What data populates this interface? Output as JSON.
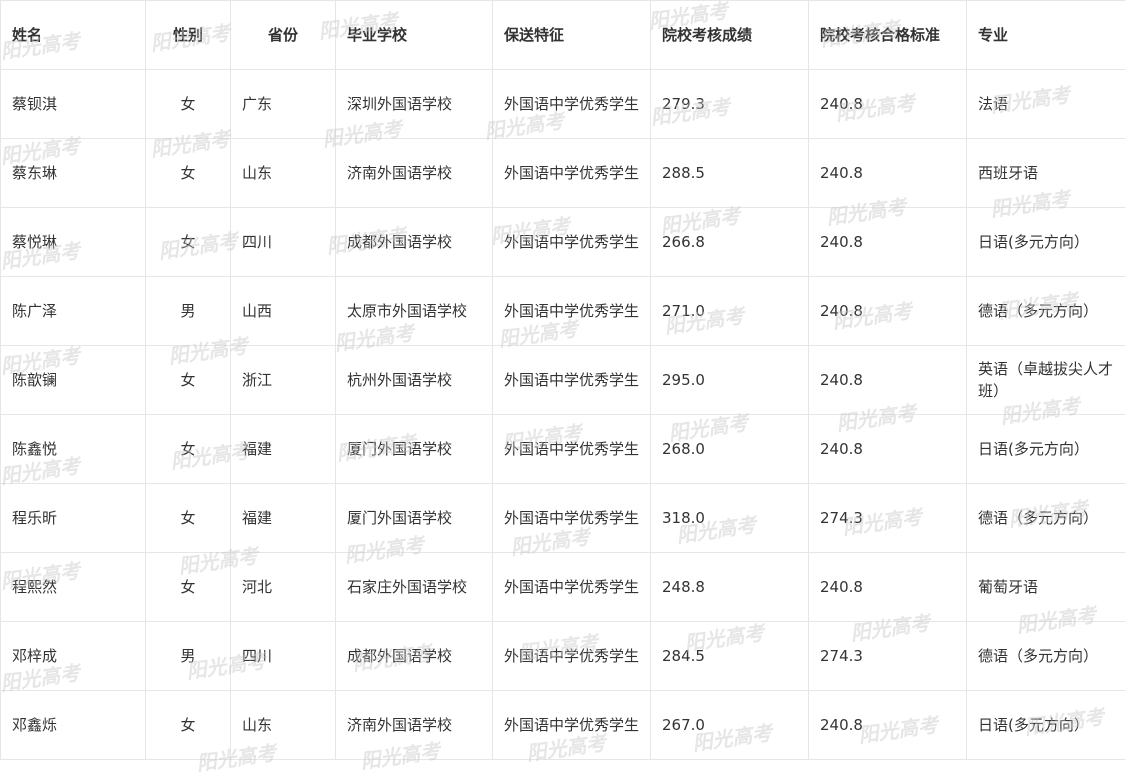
{
  "table": {
    "headers": [
      "姓名",
      "性别",
      "省份",
      "毕业学校",
      "保送特征",
      "院校考核成绩",
      "院校考核合格标准",
      "专业"
    ],
    "rows": [
      [
        "蔡钡淇",
        "女",
        "广东",
        "深圳外国语学校",
        "外国语中学优秀学生",
        "279.3",
        "240.8",
        "法语"
      ],
      [
        "蔡东琳",
        "女",
        "山东",
        "济南外国语学校",
        "外国语中学优秀学生",
        "288.5",
        "240.8",
        "西班牙语"
      ],
      [
        "蔡悦琳",
        "女",
        "四川",
        "成都外国语学校",
        "外国语中学优秀学生",
        "266.8",
        "240.8",
        "日语(多元方向）"
      ],
      [
        "陈广泽",
        "男",
        "山西",
        "太原市外国语学校",
        "外国语中学优秀学生",
        "271.0",
        "240.8",
        "德语（多元方向）"
      ],
      [
        "陈歆镧",
        "女",
        "浙江",
        "杭州外国语学校",
        "外国语中学优秀学生",
        "295.0",
        "240.8",
        "英语（卓越拔尖人才班）"
      ],
      [
        "陈鑫悦",
        "女",
        "福建",
        "厦门外国语学校",
        "外国语中学优秀学生",
        "268.0",
        "240.8",
        "日语(多元方向）"
      ],
      [
        "程乐昕",
        "女",
        "福建",
        "厦门外国语学校",
        "外国语中学优秀学生",
        "318.0",
        "274.3",
        "德语（多元方向）"
      ],
      [
        "程熙然",
        "女",
        "河北",
        "石家庄外国语学校",
        "外国语中学优秀学生",
        "248.8",
        "240.8",
        "葡萄牙语"
      ],
      [
        "邓梓成",
        "男",
        "四川",
        "成都外国语学校",
        "外国语中学优秀学生",
        "284.5",
        "274.3",
        "德语（多元方向）"
      ],
      [
        "邓鑫烁",
        "女",
        "山东",
        "济南外国语学校",
        "外国语中学优秀学生",
        "267.0",
        "240.8",
        "日语(多元方向）"
      ]
    ]
  },
  "watermark": {
    "text": "阳光高考"
  }
}
